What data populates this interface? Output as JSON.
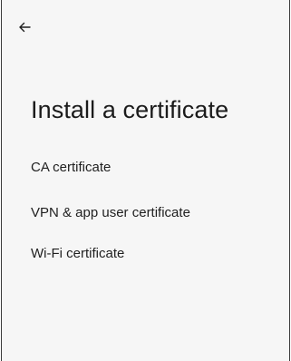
{
  "header": {
    "back_icon": "arrow-back-icon",
    "title": "Install a certificate"
  },
  "options": [
    {
      "label": "CA certificate"
    },
    {
      "label": "VPN & app user certificate"
    },
    {
      "label": "Wi-Fi certificate"
    }
  ],
  "colors": {
    "background": "#f6f6f6",
    "text": "#1b1b1b"
  }
}
